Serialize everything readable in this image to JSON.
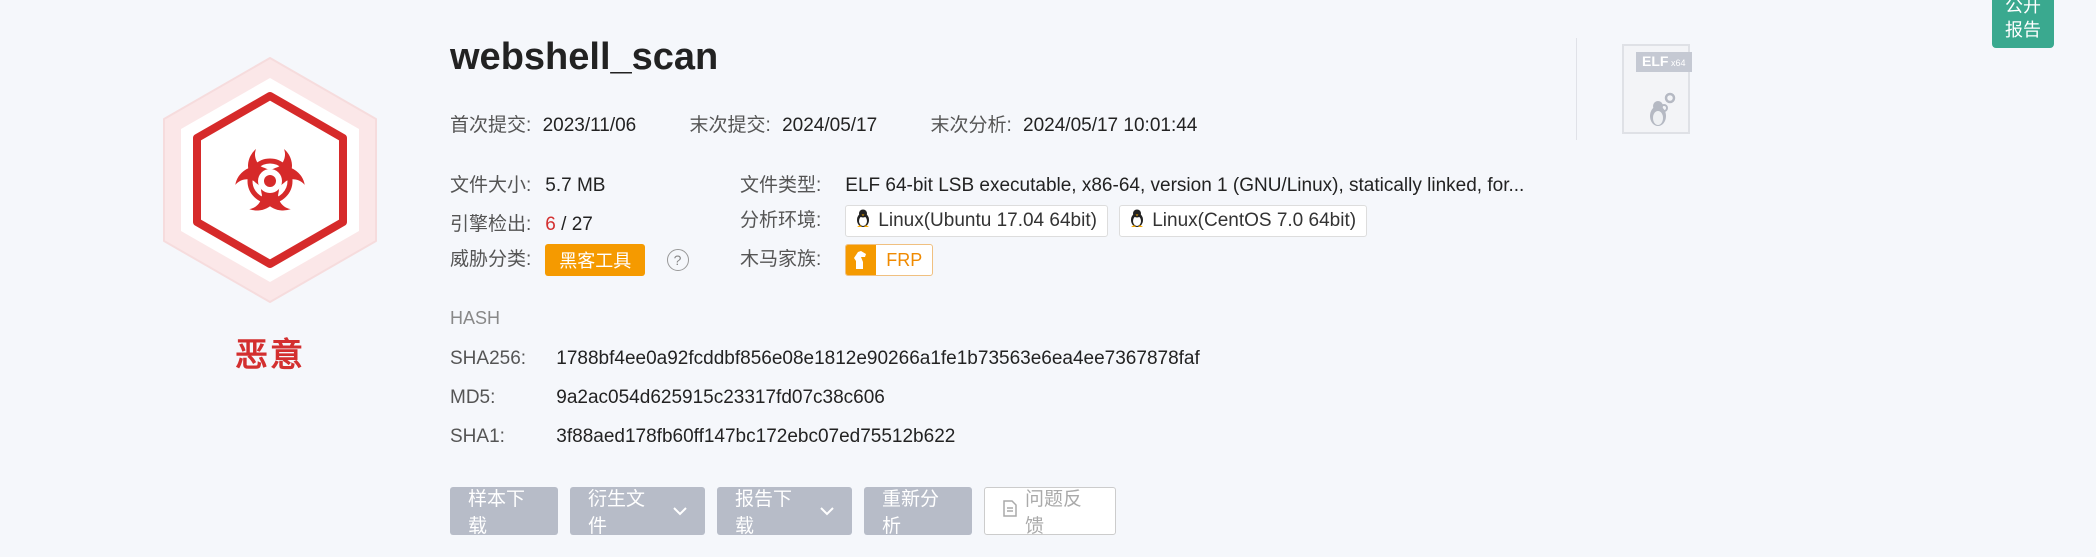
{
  "verdict": {
    "label": "恶意",
    "color": "#d32f2f",
    "icon": "biohazard-icon"
  },
  "file": {
    "name": "webshell_scan",
    "first_submit_label": "首次提交:",
    "first_submit": "2023/11/06",
    "last_submit_label": "末次提交:",
    "last_submit": "2024/05/17",
    "last_analysis_label": "末次分析:",
    "last_analysis": "2024/05/17 10:01:44",
    "size_label": "文件大小:",
    "size": "5.7 MB",
    "type_label": "文件类型:",
    "type": "ELF 64-bit LSB executable, x86-64, version 1 (GNU/Linux), statically linked, for...",
    "detection_label": "引擎检出:",
    "detection_hits": "6",
    "detection_sep": " / ",
    "detection_total": "27",
    "env_label": "分析环境:",
    "envs": [
      "Linux(Ubuntu 17.04 64bit)",
      "Linux(CentOS 7.0 64bit)"
    ],
    "threat_label": "威胁分类:",
    "threat_tag": "黑客工具",
    "threat_tag_color": "#f59a00",
    "family_label": "木马家族:",
    "family": "FRP",
    "format_badge": "ELF",
    "format_arch": "x64"
  },
  "hash": {
    "heading": "HASH",
    "sha256_label": "SHA256:",
    "sha256": "1788bf4ee0a92fcddbf856e08e1812e90266a1fe1b73563e6ea4ee7367878faf",
    "md5_label": "MD5:",
    "md5": "9a2ac054d625915c23317fd07c38c606",
    "sha1_label": "SHA1:",
    "sha1": "3f88aed178fb60ff147bc172ebc07ed75512b622"
  },
  "actions": {
    "download_sample": "样本下载",
    "derived_files": "衍生文件",
    "report_download": "报告下载",
    "reanalyze": "重新分析",
    "feedback": "问题反馈"
  },
  "public_report": {
    "line1": "公开",
    "line2": "报告",
    "color": "#3aa98f"
  }
}
